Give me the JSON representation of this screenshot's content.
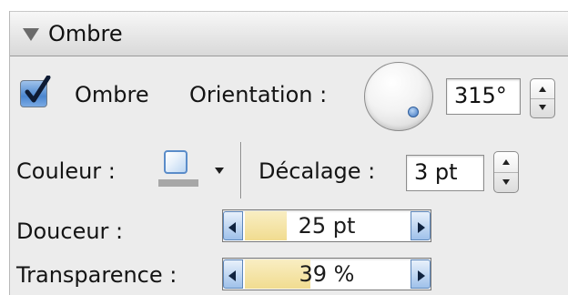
{
  "section": {
    "title": "Ombre"
  },
  "shadow": {
    "checkbox_label": "Ombre",
    "checked": true,
    "orientation_label": "Orientation :",
    "orientation_value": "315°",
    "color_label": "Couleur :",
    "offset_label": "Décalage :",
    "offset_value": "3 pt",
    "softness_label": "Douceur :",
    "softness_value": "25 pt",
    "softness_fraction": 0.25,
    "transparency_label": "Transparence :",
    "transparency_value": "39 %",
    "transparency_fraction": 0.39
  },
  "icons": {
    "disclosure": "disclosure-triangle-down-icon",
    "check": "checkmark-icon",
    "dial": "angle-dial-icon",
    "stepper_up": "chevron-up-icon",
    "stepper_down": "chevron-down-icon",
    "popup": "popup-arrow-icon",
    "slider_left": "arrow-left-icon",
    "slider_right": "arrow-right-icon"
  },
  "colors": {
    "accent_blue": "#4b86cf",
    "slider_fill": "#f1dc90",
    "panel_bg": "#ececec"
  }
}
